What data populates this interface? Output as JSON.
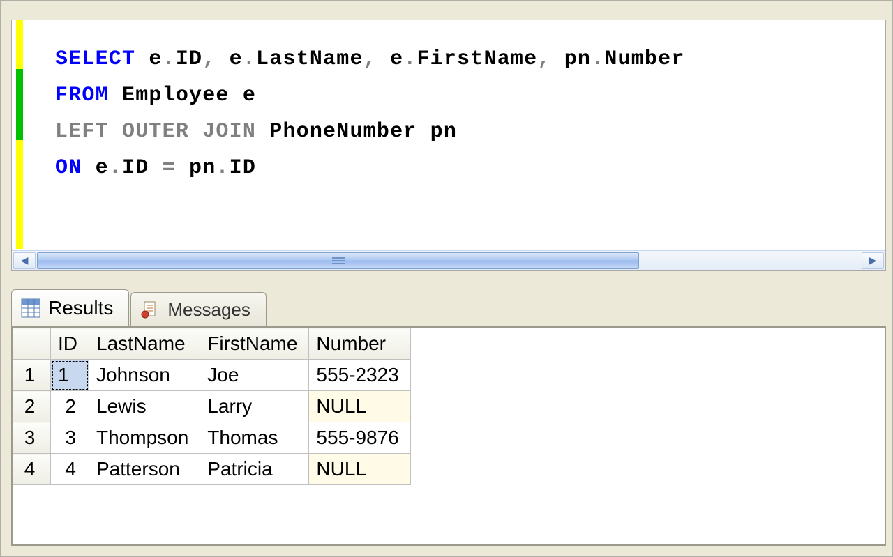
{
  "editor": {
    "tokens": [
      [
        {
          "t": "SELECT",
          "c": "kw"
        },
        {
          "t": " ",
          "c": ""
        },
        {
          "t": "e",
          "c": "id"
        },
        {
          "t": ".",
          "c": "op"
        },
        {
          "t": "ID",
          "c": "id"
        },
        {
          "t": ",",
          "c": "op"
        },
        {
          "t": " ",
          "c": ""
        },
        {
          "t": "e",
          "c": "id"
        },
        {
          "t": ".",
          "c": "op"
        },
        {
          "t": "LastName",
          "c": "id"
        },
        {
          "t": ",",
          "c": "op"
        },
        {
          "t": " ",
          "c": ""
        },
        {
          "t": "e",
          "c": "id"
        },
        {
          "t": ".",
          "c": "op"
        },
        {
          "t": "FirstName",
          "c": "id"
        },
        {
          "t": ",",
          "c": "op"
        },
        {
          "t": " ",
          "c": ""
        },
        {
          "t": "pn",
          "c": "id"
        },
        {
          "t": ".",
          "c": "op"
        },
        {
          "t": "Number",
          "c": "id"
        }
      ],
      [
        {
          "t": "FROM",
          "c": "kw"
        },
        {
          "t": " Employee e",
          "c": "id"
        }
      ],
      [
        {
          "t": "LEFT",
          "c": "gray"
        },
        {
          "t": " ",
          "c": ""
        },
        {
          "t": "OUTER",
          "c": "gray"
        },
        {
          "t": " ",
          "c": ""
        },
        {
          "t": "JOIN",
          "c": "gray"
        },
        {
          "t": " PhoneNumber pn",
          "c": "id"
        }
      ],
      [
        {
          "t": "ON",
          "c": "kw"
        },
        {
          "t": " e",
          "c": "id"
        },
        {
          "t": ".",
          "c": "op"
        },
        {
          "t": "ID ",
          "c": "id"
        },
        {
          "t": "=",
          "c": "op"
        },
        {
          "t": " pn",
          "c": "id"
        },
        {
          "t": ".",
          "c": "op"
        },
        {
          "t": "ID",
          "c": "id"
        }
      ]
    ]
  },
  "tabs": {
    "results": "Results",
    "messages": "Messages"
  },
  "grid": {
    "columns": [
      "ID",
      "LastName",
      "FirstName",
      "Number"
    ],
    "rows": [
      {
        "n": "1",
        "ID": "1",
        "LastName": "Johnson",
        "FirstName": "Joe",
        "Number": "555-2323",
        "null": false,
        "sel": true
      },
      {
        "n": "2",
        "ID": "2",
        "LastName": "Lewis",
        "FirstName": "Larry",
        "Number": "NULL",
        "null": true,
        "sel": false
      },
      {
        "n": "3",
        "ID": "3",
        "LastName": "Thompson",
        "FirstName": "Thomas",
        "Number": "555-9876",
        "null": false,
        "sel": false
      },
      {
        "n": "4",
        "ID": "4",
        "LastName": "Patterson",
        "FirstName": "Patricia",
        "Number": "NULL",
        "null": true,
        "sel": false
      }
    ]
  }
}
